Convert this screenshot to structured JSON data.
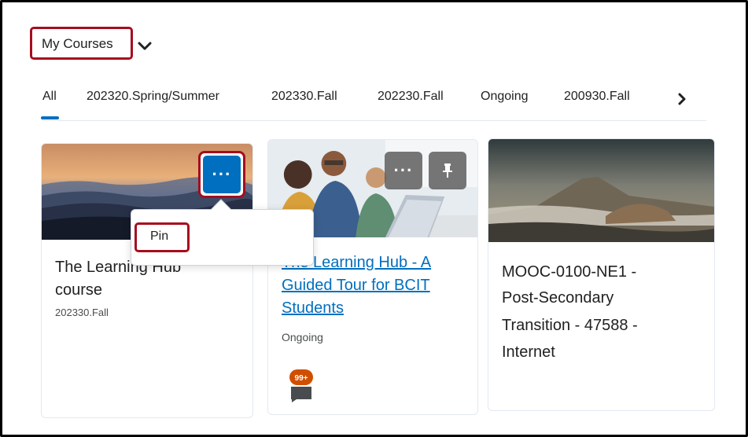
{
  "header": {
    "title": "My Courses"
  },
  "tabs": {
    "items": [
      {
        "label": "All"
      },
      {
        "label": "202320.Spring/Summer"
      },
      {
        "label": "202330.Fall"
      },
      {
        "label": "202230.Fall"
      },
      {
        "label": "Ongoing"
      },
      {
        "label": "200930.Fall"
      }
    ]
  },
  "context_menu": {
    "pin_label": "Pin"
  },
  "courses": [
    {
      "title_line1": "The Learning Hub",
      "title_line2": "course",
      "term": "202330.Fall"
    },
    {
      "title_line1": "The Learning Hub - A",
      "title_line2": "Guided Tour for BCIT",
      "title_line3": "Students",
      "term": "Ongoing",
      "badge": "99+"
    },
    {
      "title_line1": "MOOC-0100-NE1 -",
      "title_line2": "Post-Secondary",
      "title_line3": "Transition - 47588 -",
      "title_line4": "Internet"
    }
  ],
  "colors": {
    "accent": "#006fbf",
    "highlight": "#a50d1f",
    "badge": "#d04e00"
  },
  "icons": {
    "dropdown": "chevron-down-icon",
    "next": "chevron-right-icon",
    "options": "more-options-icon",
    "pin": "pin-icon",
    "alerts": "discussion-badge-icon"
  }
}
